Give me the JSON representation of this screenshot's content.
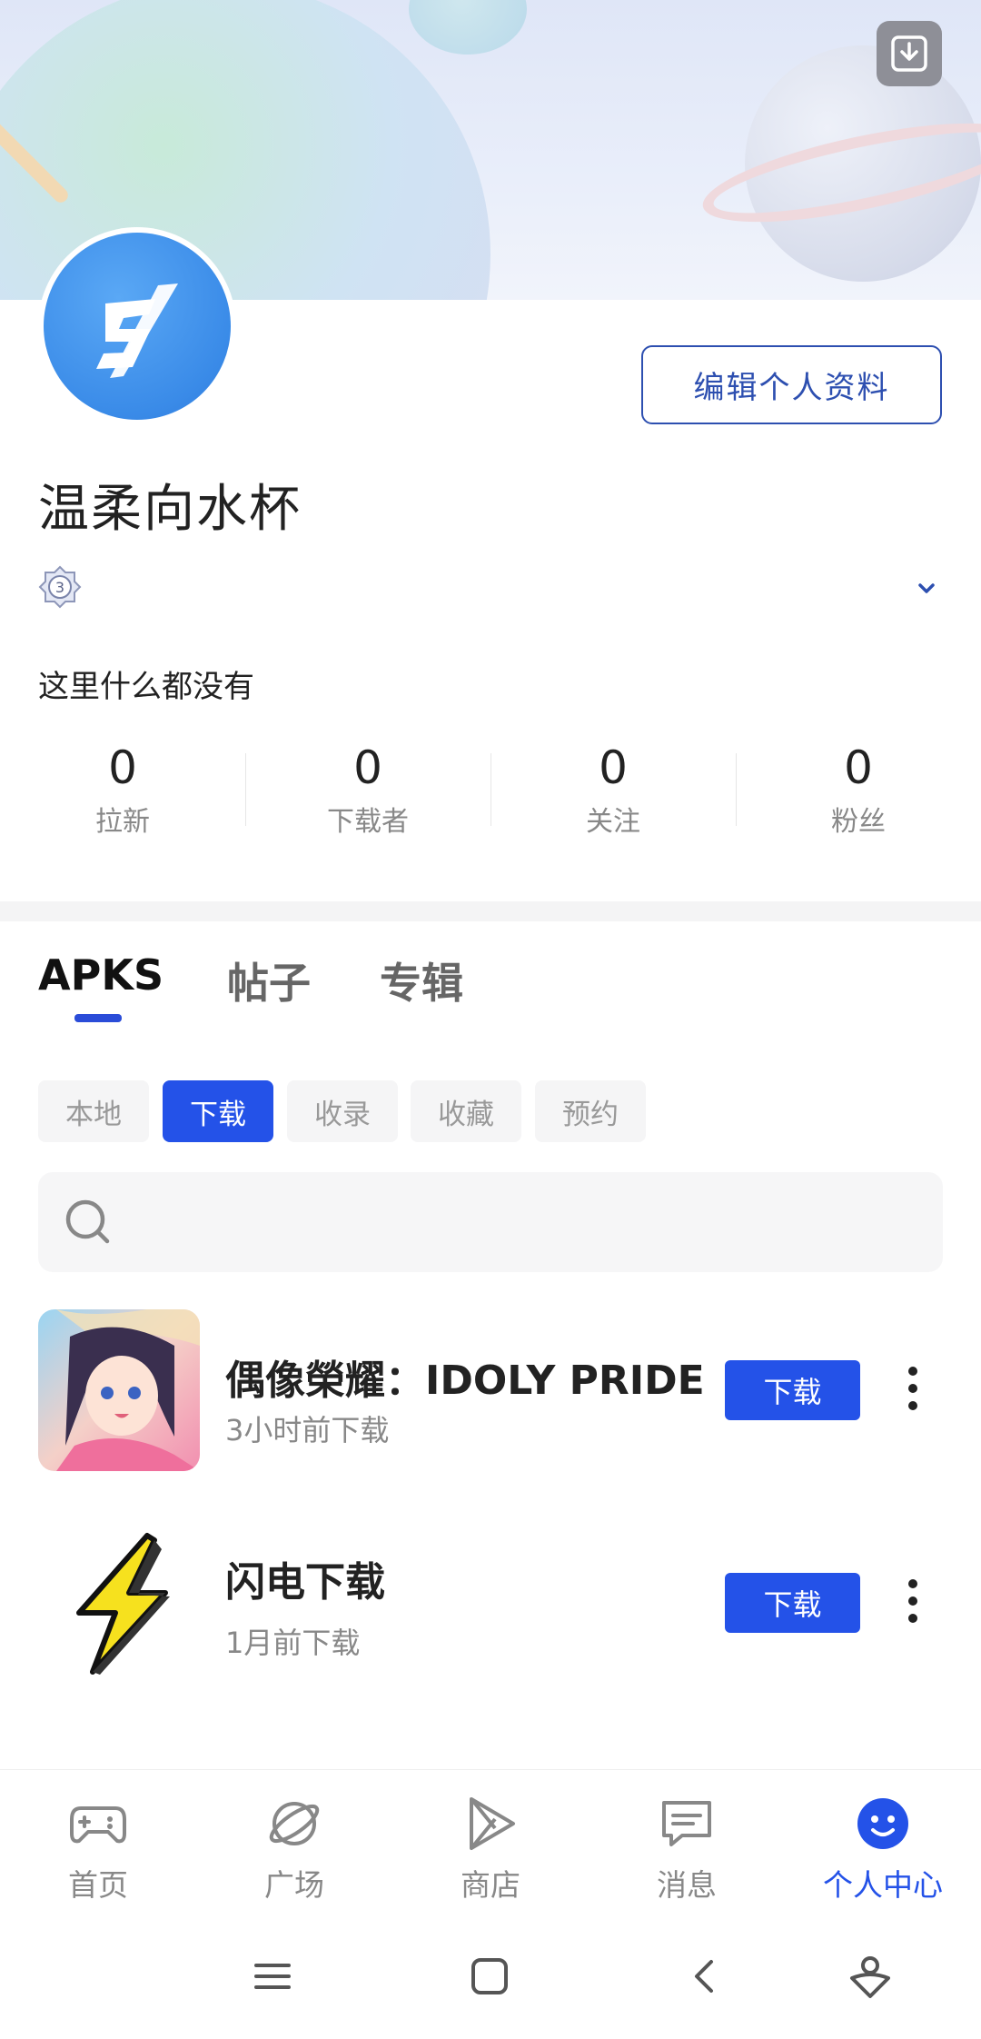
{
  "header": {
    "save_icon": "download-save-icon"
  },
  "profile": {
    "username": "温柔向水杯",
    "edit_button_label": "编辑个人资料",
    "level_icon": "level-3-badge-icon",
    "level": "3",
    "bio": "这里什么都没有"
  },
  "stats": [
    {
      "value": "0",
      "label": "拉新"
    },
    {
      "value": "0",
      "label": "下载者"
    },
    {
      "value": "0",
      "label": "关注"
    },
    {
      "value": "0",
      "label": "粉丝"
    }
  ],
  "tabs": [
    {
      "label": "APKS",
      "active": true
    },
    {
      "label": "帖子",
      "active": false
    },
    {
      "label": "专辑",
      "active": false
    }
  ],
  "filters": [
    {
      "label": "本地",
      "active": false
    },
    {
      "label": "下载",
      "active": true
    },
    {
      "label": "收录",
      "active": false
    },
    {
      "label": "收藏",
      "active": false
    },
    {
      "label": "预约",
      "active": false
    }
  ],
  "search": {
    "placeholder": ""
  },
  "apps": [
    {
      "name": "偶像榮耀：IDOLY PRIDE",
      "time": "3小时前下载",
      "button": "下载"
    },
    {
      "name": "闪电下载",
      "time": "1月前下载",
      "button": "下载"
    }
  ],
  "bottom_nav": [
    {
      "label": "首页",
      "icon": "gamepad-icon",
      "active": false
    },
    {
      "label": "广场",
      "icon": "planet-icon",
      "active": false
    },
    {
      "label": "商店",
      "icon": "play-store-icon",
      "active": false
    },
    {
      "label": "消息",
      "icon": "message-icon",
      "active": false
    },
    {
      "label": "个人中心",
      "icon": "smiley-profile-icon",
      "active": true
    }
  ],
  "colors": {
    "accent": "#2452e8",
    "edit_border": "#2d4fb0"
  }
}
